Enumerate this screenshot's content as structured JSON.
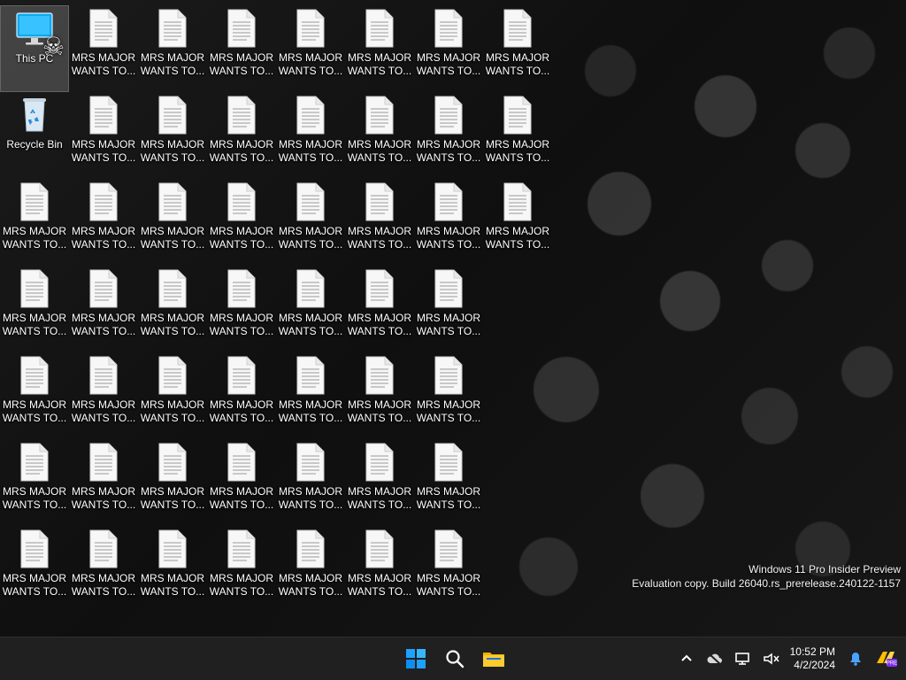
{
  "desktop": {
    "system_icons": {
      "this_pc": {
        "label": "This PC",
        "icon": "computer-icon",
        "overlay": "skull-crossbones-icon"
      },
      "recycle_bin": {
        "label": "Recycle Bin",
        "icon": "recycle-bin-icon"
      }
    },
    "file_icon": {
      "label": "MRS MAJOR\nWANTS TO...",
      "icon": "text-document-icon"
    }
  },
  "watermark": {
    "line1": "Windows 11 Pro Insider Preview",
    "line2": "Evaluation copy. Build 26040.rs_prerelease.240122-1157"
  },
  "taskbar": {
    "start_icon": "windows-start-icon",
    "search_icon": "search-icon",
    "file_explorer_icon": "file-explorer-icon",
    "tray": {
      "overflow_icon": "chevron-up-icon",
      "cloud_icon": "cloud-off-icon",
      "network_icon": "network-icon",
      "volume_icon": "volume-muted-icon",
      "time": "10:52 PM",
      "date": "4/2/2024",
      "notification_icon": "bell-icon",
      "copilot_icon": "copilot-pre-icon",
      "badge_text": "PRE"
    }
  },
  "colors": {
    "taskbar": "#202020",
    "accent_blue": "#1ea1ff",
    "folder_yellow": "#f0b400",
    "bell_blue": "#4aa3ff"
  }
}
